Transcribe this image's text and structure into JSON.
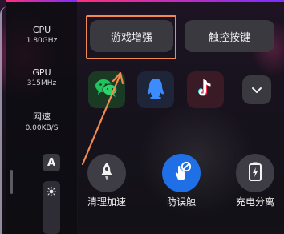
{
  "stats": {
    "cpu": {
      "label": "CPU",
      "value": "1.80GHz"
    },
    "gpu": {
      "label": "GPU",
      "value": "315MHz"
    },
    "net": {
      "label": "网速",
      "value": "0.00KB/S"
    }
  },
  "side_controls": {
    "mode_label": "A",
    "brightness_icon": "sun-icon"
  },
  "tabs": [
    {
      "label": "游戏增强",
      "selected": true
    },
    {
      "label": "触控按键",
      "selected": false
    }
  ],
  "apps": [
    {
      "icon": "wechat-icon"
    },
    {
      "icon": "qq-icon"
    },
    {
      "icon": "tiktok-icon"
    },
    {
      "icon": "chevron-down-icon"
    }
  ],
  "actions": [
    {
      "label": "清理加速",
      "icon": "rocket-icon"
    },
    {
      "label": "防误触",
      "icon": "no-touch-icon",
      "active": true
    },
    {
      "label": "充电分离",
      "icon": "battery-bolt-icon"
    }
  ],
  "colors": {
    "highlight_box": "#f08a50",
    "annotation_arrow": "#f08a50",
    "active_action": "#1f6fe6",
    "wechat": "#22c35e",
    "qq": "#3d8cff"
  }
}
